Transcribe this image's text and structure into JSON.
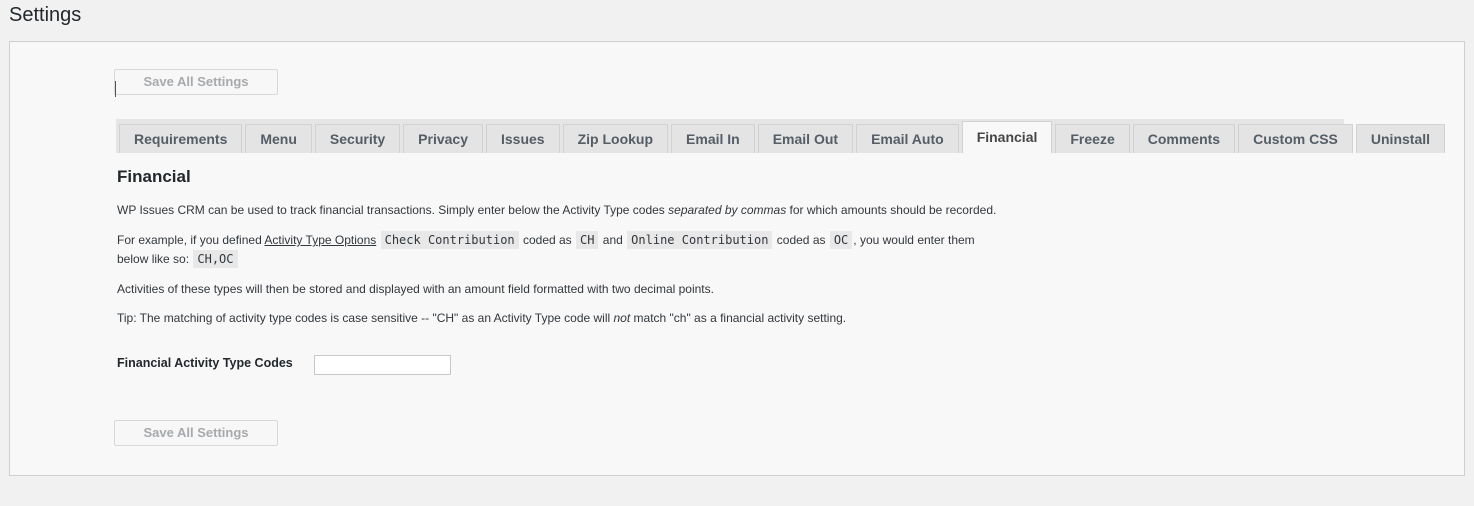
{
  "page": {
    "title": "Settings"
  },
  "buttons": {
    "save_top": "Save All Settings",
    "save_bottom": "Save All Settings"
  },
  "tabs": [
    {
      "label": "Requirements"
    },
    {
      "label": "Menu"
    },
    {
      "label": "Security"
    },
    {
      "label": "Privacy"
    },
    {
      "label": "Issues"
    },
    {
      "label": "Zip Lookup"
    },
    {
      "label": "Email In"
    },
    {
      "label": "Email Out"
    },
    {
      "label": "Email Auto"
    },
    {
      "label": "Financial"
    },
    {
      "label": "Freeze"
    },
    {
      "label": "Comments"
    },
    {
      "label": "Custom CSS"
    },
    {
      "label": "Uninstall"
    }
  ],
  "active_tab": "Financial",
  "section": {
    "title": "Financial",
    "p1": {
      "before": "WP Issues CRM can be used to track financial transactions. Simply enter below the Activity Type codes ",
      "emphasis": "separated by commas",
      "after": " for which amounts should be recorded."
    },
    "p2": {
      "text1": "For example, if you defined ",
      "link": "Activity Type Options",
      "code1": "Check Contribution",
      "text2": " coded as ",
      "code2": "CH",
      "text3": " and ",
      "code3": "Online Contribution",
      "text4": " coded as ",
      "code4": "OC",
      "text5": ", you would enter them",
      "text6": "below like so: ",
      "code5": "CH,OC"
    },
    "p3": "Activities of these types will then be stored and displayed with an amount field formatted with two decimal points.",
    "p4": {
      "before": "Tip: The matching of activity type codes is case sensitive -- \"CH\" as an Activity Type code will ",
      "emphasis": "not",
      "after": " match \"ch\" as a financial activity setting."
    }
  },
  "field": {
    "label": "Financial Activity Type Codes",
    "value": ""
  }
}
